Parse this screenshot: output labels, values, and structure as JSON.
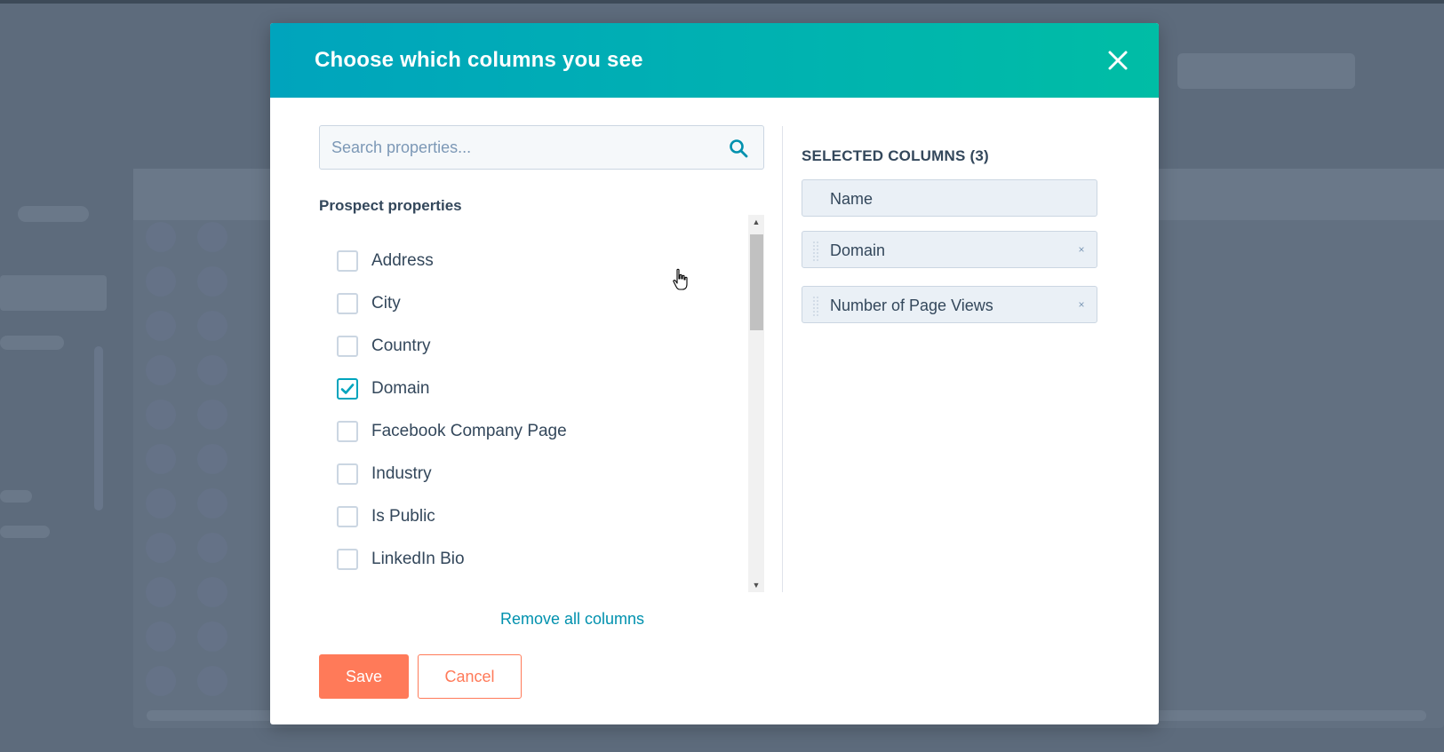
{
  "modal": {
    "title": "Choose which columns you see",
    "close_icon": "close-icon"
  },
  "search": {
    "placeholder": "Search properties...",
    "value": "",
    "icon": "search-icon"
  },
  "properties": {
    "heading": "Prospect properties",
    "items": [
      {
        "label": "Address",
        "checked": false
      },
      {
        "label": "City",
        "checked": false
      },
      {
        "label": "Country",
        "checked": false
      },
      {
        "label": "Domain",
        "checked": true
      },
      {
        "label": "Facebook Company Page",
        "checked": false
      },
      {
        "label": "Industry",
        "checked": false
      },
      {
        "label": "Is Public",
        "checked": false
      },
      {
        "label": "LinkedIn Bio",
        "checked": false
      }
    ]
  },
  "remove_all_label": "Remove all columns",
  "selected": {
    "heading": "SELECTED COLUMNS (3)",
    "items": [
      {
        "label": "Name",
        "removable": false
      },
      {
        "label": "Domain",
        "removable": true
      },
      {
        "label": "Number of Page Views",
        "removable": true
      }
    ],
    "remove_glyph": "×"
  },
  "footer": {
    "save_label": "Save",
    "cancel_label": "Cancel"
  },
  "colors": {
    "header_start": "#00a4bd",
    "header_end": "#00bda5",
    "accent_orange": "#ff7a59",
    "link_teal": "#0091ae",
    "text_dark": "#33475b"
  }
}
